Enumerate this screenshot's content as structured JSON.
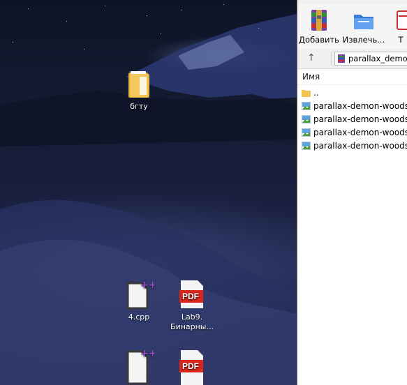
{
  "desktop": {
    "icons": [
      {
        "label": "бгту",
        "type": "folder"
      },
      {
        "label": "4.cpp",
        "type": "cpp-file"
      },
      {
        "label": "Lab9.\nБинарны...",
        "type": "pdf-file"
      },
      {
        "label": "",
        "type": "cpp-file"
      },
      {
        "label": "",
        "type": "pdf-file"
      }
    ],
    "pdf_badge": "PDF"
  },
  "winrar": {
    "toolbar": {
      "add_label": "Добавить",
      "extract_label": "Извлечь...",
      "third_label": "Т"
    },
    "address": {
      "path": "parallax_demon-woods"
    },
    "columns": {
      "name": "Имя"
    },
    "files": [
      {
        "name": "..",
        "type": "folder-up"
      },
      {
        "name": "parallax-demon-woods-b",
        "type": "image"
      },
      {
        "name": "parallax-demon-woods-c",
        "type": "image"
      },
      {
        "name": "parallax-demon-woods-fa",
        "type": "image"
      },
      {
        "name": "parallax-demon-woods-n",
        "type": "image"
      }
    ]
  },
  "colors": {
    "pdf_red": "#d9261c",
    "folder_yellow": "#f2c553",
    "sky_dark": "#0e1426"
  }
}
